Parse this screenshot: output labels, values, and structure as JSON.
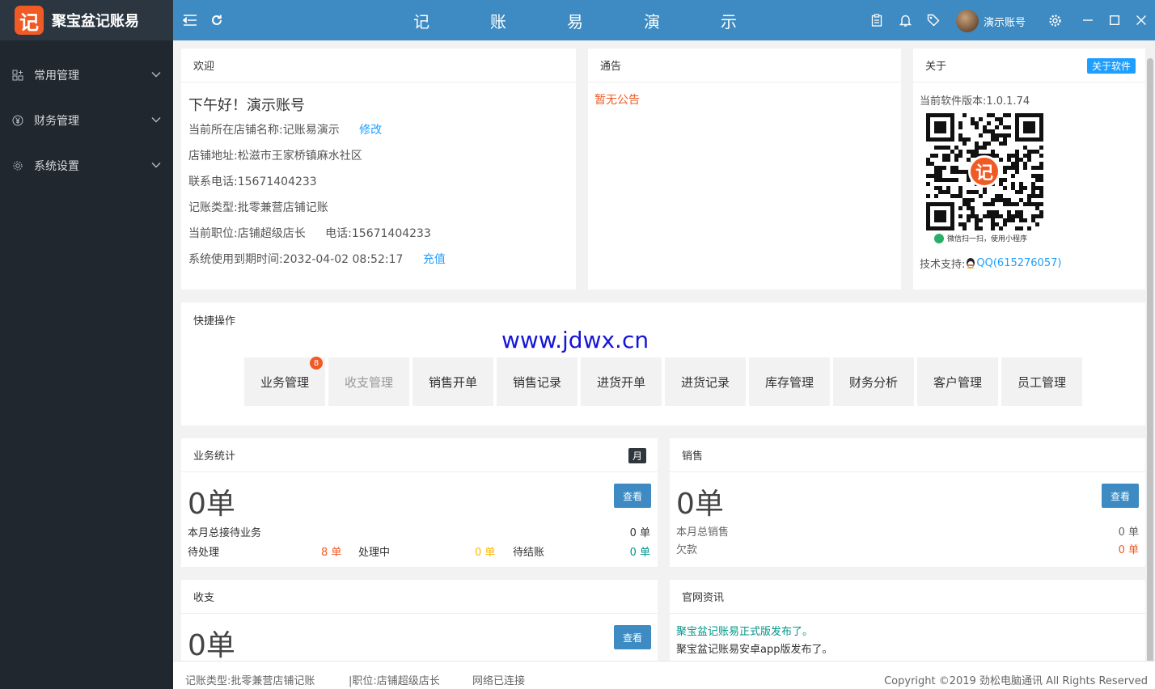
{
  "app": {
    "logo_char": "记",
    "name": "聚宝盆记账易"
  },
  "sidebar": {
    "items": [
      {
        "label": "常用管理",
        "icon": "grid-icon"
      },
      {
        "label": "财务管理",
        "icon": "yen-icon"
      },
      {
        "label": "系统设置",
        "icon": "gear-icon"
      }
    ]
  },
  "header": {
    "title_chars": [
      "记",
      "账",
      "易",
      "演",
      "示"
    ],
    "user_name": "演示账号"
  },
  "welcome": {
    "title": "欢迎",
    "greeting": "下午好！演示账号",
    "store_name": "当前所在店铺名称:记账易演示",
    "edit_link": "修改",
    "address": "店铺地址:松滋市王家桥镇麻水社区",
    "phone": "联系电话:15671404233",
    "account_type": "记账类型:批零兼营店铺记账",
    "position": "当前职位:店铺超级店长",
    "position_phone": "电话:15671404233",
    "expiry": "系统使用到期时间:2032-04-02 08:52:17",
    "recharge_link": "充值"
  },
  "notice": {
    "title": "通告",
    "empty": "暂无公告"
  },
  "about": {
    "title": "关于",
    "tag": "关于软件",
    "version": "当前软件版本:1.0.1.74",
    "qr_center": "记",
    "qr_caption": "微信扫一扫，使用小程序",
    "support_label": "技术支持:",
    "support_qq": "QQ(615276057)"
  },
  "quick": {
    "title": "快捷操作",
    "watermark": "www.jdwx.cn",
    "buttons": [
      {
        "label": "业务管理",
        "badge": "8"
      },
      {
        "label": "收支管理"
      },
      {
        "label": "销售开单"
      },
      {
        "label": "销售记录"
      },
      {
        "label": "进货开单"
      },
      {
        "label": "进货记录"
      },
      {
        "label": "库存管理"
      },
      {
        "label": "财务分析"
      },
      {
        "label": "客户管理"
      },
      {
        "label": "员工管理"
      }
    ]
  },
  "business": {
    "title": "业务统计",
    "period_tag": "月",
    "total": "0单",
    "view": "查看",
    "monthly_label": "本月总接待业务",
    "monthly_value": "0 单",
    "pending_label": "待处理",
    "pending_value": "8 单",
    "processing_label": "处理中",
    "processing_value": "0 单",
    "settle_label": "待结账",
    "settle_value": "0 单"
  },
  "sales": {
    "title": "销售",
    "total": "0单",
    "view": "查看",
    "monthly_label": "本月总销售",
    "monthly_value": "0 单",
    "debt_label": "欠款",
    "debt_value": "0 单"
  },
  "income": {
    "title": "收支",
    "total": "0单",
    "view": "查看"
  },
  "news": {
    "title": "官网资讯",
    "items": [
      "聚宝盆记账易正式版发布了。",
      "聚宝盆记账易安卓app版发布了。"
    ]
  },
  "footer": {
    "account_type": "记账类型:批零兼营店铺记账",
    "position": "|职位:店铺超级店长",
    "network": "网络已连接",
    "copyright": "Copyright ©2019 劲松电脑通讯 All Rights Reserved"
  },
  "colors": {
    "header": "#3d8bc2",
    "sidebar": "#20272f",
    "accent_orange": "#f05a24",
    "link_blue": "#1e9fff"
  }
}
